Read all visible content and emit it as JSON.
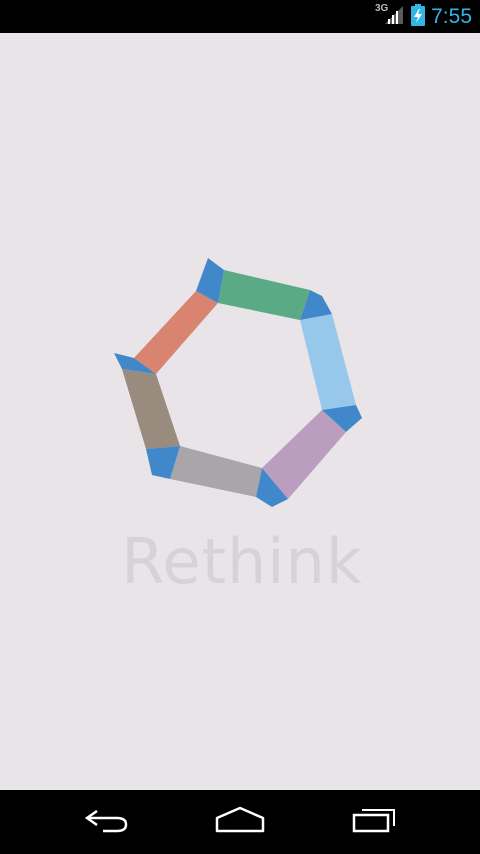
{
  "status_bar": {
    "network_type": "3G",
    "time": "7:55",
    "signal_icon": "signal-icon",
    "battery_icon": "battery-charging-icon"
  },
  "splash": {
    "app_name": "Rethink",
    "logo_icon": "heptagon-logo-icon"
  },
  "nav_bar": {
    "back_icon": "back-icon",
    "home_icon": "home-icon",
    "recents_icon": "recent-apps-icon"
  },
  "colors": {
    "background": "#e9e4e8",
    "accent": "#33b5e5",
    "logo_joint": "#4188cb",
    "logo_segments": [
      "#d98470",
      "#5aaa86",
      "#97c7ea",
      "#bb9ebf",
      "#a8a6a9",
      "#998b7e"
    ]
  }
}
